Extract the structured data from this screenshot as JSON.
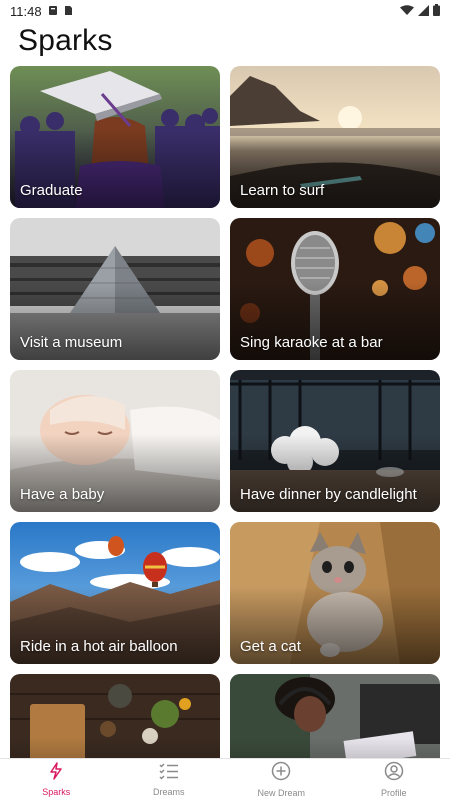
{
  "status_bar": {
    "time": "11:48"
  },
  "page": {
    "title": "Sparks"
  },
  "cards": [
    {
      "label": "Graduate"
    },
    {
      "label": "Learn to surf"
    },
    {
      "label": "Visit a museum"
    },
    {
      "label": "Sing karaoke at a bar"
    },
    {
      "label": "Have a baby"
    },
    {
      "label": "Have dinner by candlelight"
    },
    {
      "label": "Ride in a hot air balloon"
    },
    {
      "label": "Get a cat"
    },
    {
      "label": ""
    },
    {
      "label": ""
    }
  ],
  "bottom_nav": {
    "items": [
      {
        "label": "Sparks",
        "icon": "sparks-icon",
        "active": true
      },
      {
        "label": "Dreams",
        "icon": "list-icon",
        "active": false
      },
      {
        "label": "New Dream",
        "icon": "add-circle-icon",
        "active": false
      },
      {
        "label": "Profile",
        "icon": "profile-icon",
        "active": false
      }
    ]
  },
  "colors": {
    "accent": "#d81b60",
    "inactive": "#8a8a8a"
  }
}
